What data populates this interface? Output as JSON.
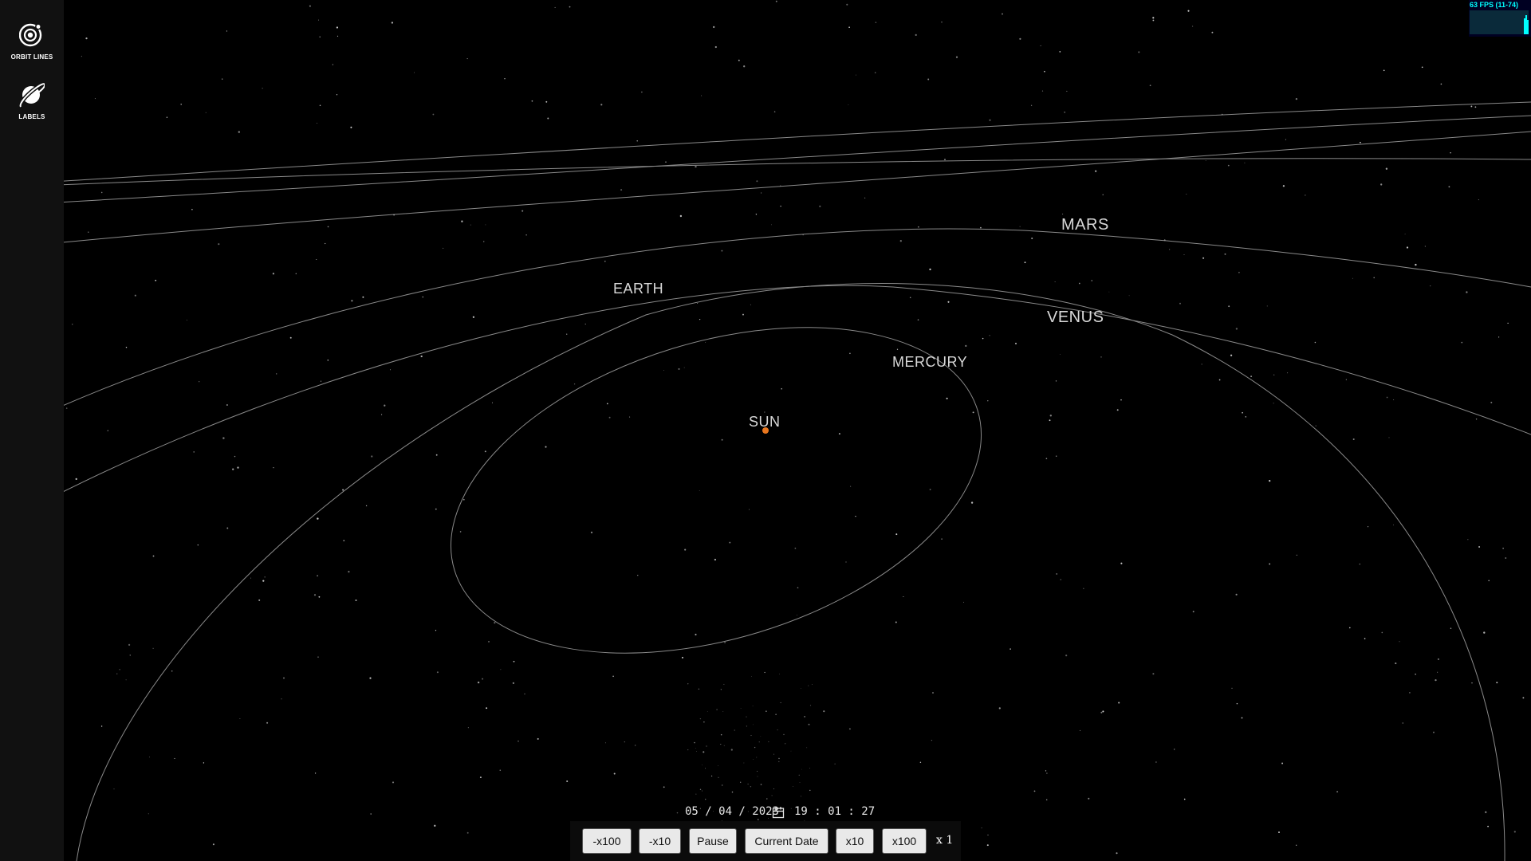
{
  "sidebar": {
    "items": [
      {
        "label": "ORBIT LINES",
        "icon": "orbit-icon"
      },
      {
        "label": "LABELS",
        "icon": "planet-icon"
      }
    ]
  },
  "planets": {
    "mars": "MARS",
    "earth": "EARTH",
    "venus": "VENUS",
    "mercury": "MERCURY",
    "sun": "SUN"
  },
  "fps": {
    "text": "63 FPS (11-74)",
    "color": "#00ffff"
  },
  "datetime": {
    "date": "05 / 04 / 2023",
    "time": "19 : 01 : 27",
    "icon": "calendar-icon"
  },
  "controls": {
    "minus100": "-x100",
    "minus10": "-x10",
    "pause": "Pause",
    "current_date": "Current Date",
    "plus10": "x10",
    "plus100": "x100",
    "speed": "x 1"
  },
  "colors": {
    "background": "#000000",
    "sidebar": "#111111",
    "sun": "#e8761e",
    "orbit_line": "#8a8a8a",
    "label": "#d8d8d8"
  }
}
